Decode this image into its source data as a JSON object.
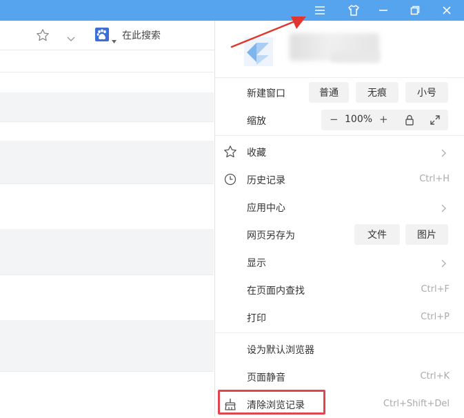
{
  "titlebar": {
    "color": "#56a3ee",
    "buttons": [
      "menu-icon",
      "skin-icon",
      "minimize-icon",
      "restore-icon",
      "close-icon"
    ]
  },
  "toolbar": {
    "search_label": "在此搜索",
    "icons": [
      "star-icon",
      "chevron-down-icon",
      "baidu-paw-icon"
    ]
  },
  "menu": {
    "new_window": {
      "label": "新建窗口",
      "options": [
        "普通",
        "无痕",
        "小号"
      ]
    },
    "zoom": {
      "label": "缩放",
      "minus": "−",
      "value": "100%",
      "plus": "+"
    },
    "items": [
      {
        "label": "收藏",
        "icon": "star-icon"
      },
      {
        "label": "历史记录",
        "icon": "clock-icon",
        "shortcut": "Ctrl+H"
      },
      {
        "label": "应用中心"
      },
      {
        "label": "网页另存为",
        "options": [
          "文件",
          "图片"
        ]
      },
      {
        "label": "显示"
      },
      {
        "label": "在页面内查找",
        "shortcut": "Ctrl+F"
      },
      {
        "label": "打印",
        "shortcut": "Ctrl+P"
      },
      {
        "label": "设为默认浏览器"
      },
      {
        "label": "页面静音",
        "shortcut": "Ctrl+K"
      },
      {
        "label": "清除浏览记录",
        "icon": "broom-icon",
        "shortcut": "Ctrl+Shift+Del"
      }
    ]
  },
  "annotation": {
    "highlight_color": "#e0454d"
  }
}
